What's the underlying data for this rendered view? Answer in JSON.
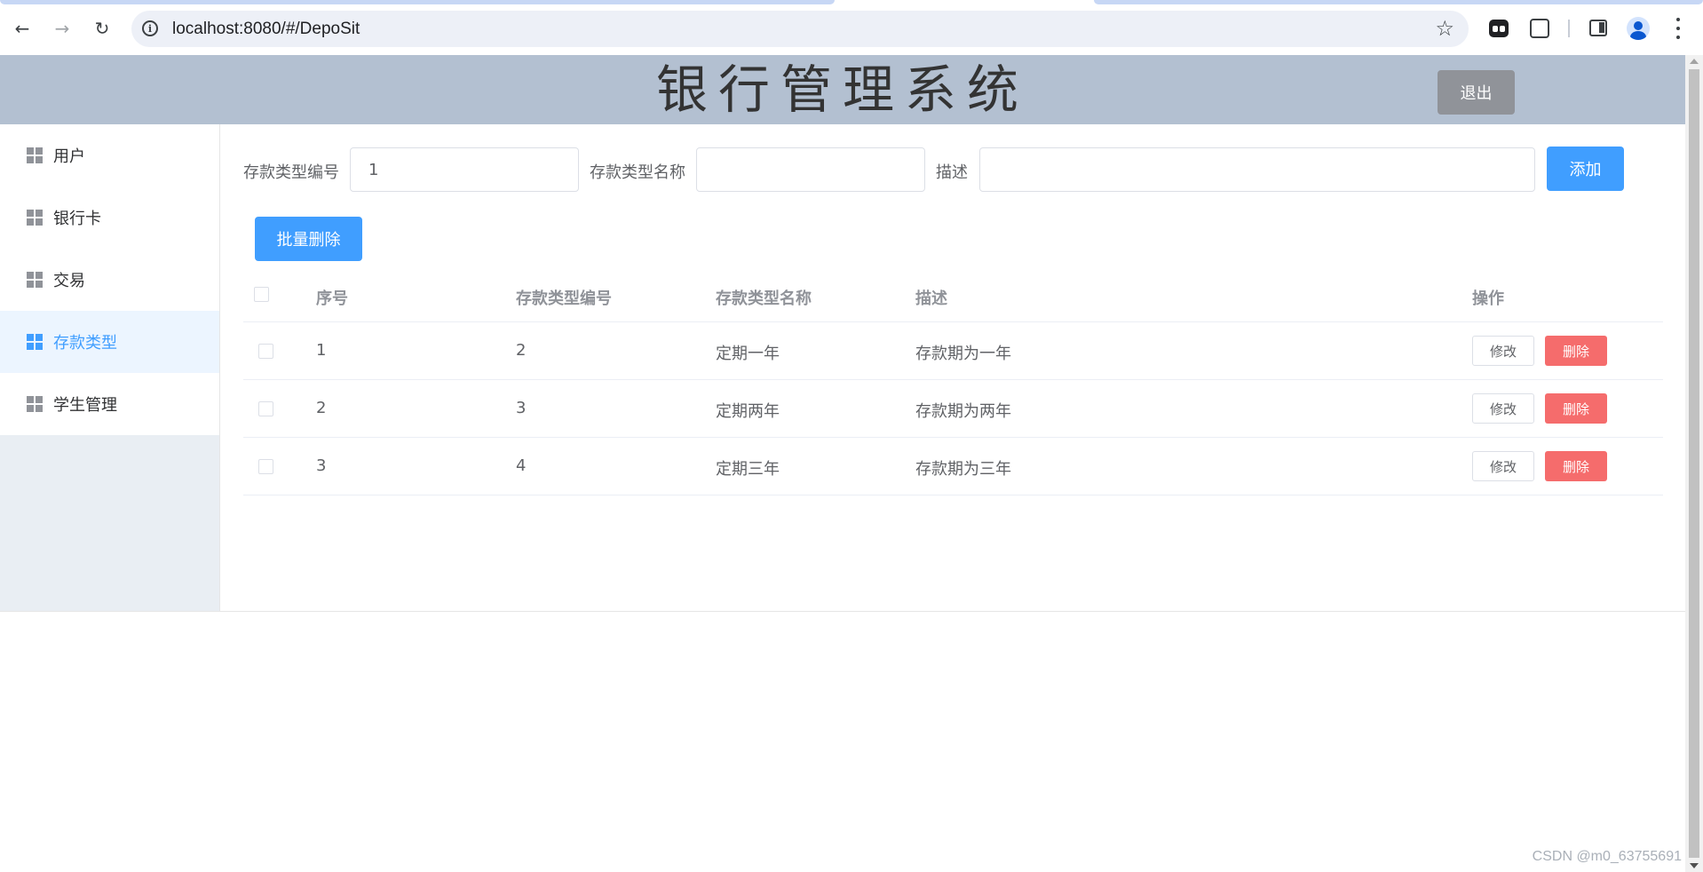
{
  "browser": {
    "url": "localhost:8080/#/DepoSit"
  },
  "header": {
    "title": "银行管理系统",
    "logout_label": "退出"
  },
  "sidebar": {
    "items": [
      {
        "label": "用户",
        "active": false
      },
      {
        "label": "银行卡",
        "active": false
      },
      {
        "label": "交易",
        "active": false
      },
      {
        "label": "存款类型",
        "active": true
      },
      {
        "label": "学生管理",
        "active": false
      }
    ]
  },
  "form": {
    "type_id_label": "存款类型编号",
    "type_id_value": "1",
    "type_name_label": "存款类型名称",
    "type_name_value": "",
    "description_label": "描述",
    "description_value": "",
    "add_label": "添加",
    "batch_delete_label": "批量删除"
  },
  "table": {
    "headers": [
      "序号",
      "存款类型编号",
      "存款类型名称",
      "描述",
      "操作"
    ],
    "rows": [
      {
        "index": "1",
        "type_id": "2",
        "type_name": "定期一年",
        "description": "存款期为一年"
      },
      {
        "index": "2",
        "type_id": "3",
        "type_name": "定期两年",
        "description": "存款期为两年"
      },
      {
        "index": "3",
        "type_id": "4",
        "type_name": "定期三年",
        "description": "存款期为三年"
      }
    ],
    "edit_label": "修改",
    "delete_label": "删除"
  },
  "watermark": "CSDN @m0_63755691",
  "colors": {
    "header_bg": "#b3c0d1",
    "primary": "#409eff",
    "danger": "#f56c6c",
    "info": "#909399"
  }
}
